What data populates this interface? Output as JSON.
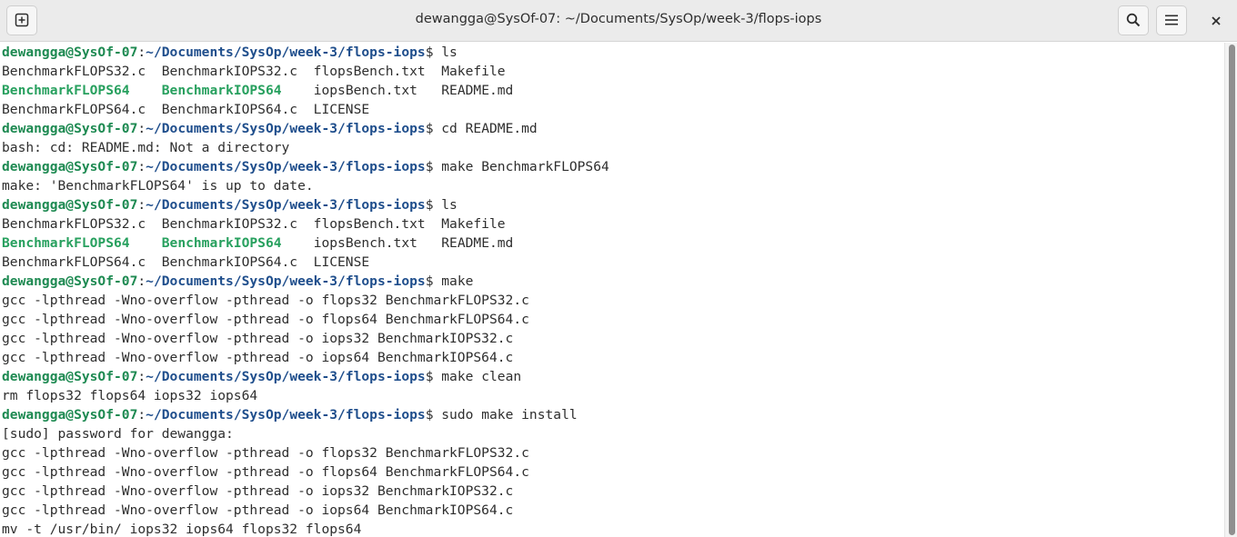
{
  "window": {
    "title": "dewangga@SysOf-07: ~/Documents/SysOp/week-3/flops-iops",
    "buttons": {
      "new_tab_icon": "new-tab-icon",
      "search_icon": "search-icon",
      "menu_icon": "hamburger-menu-icon",
      "close_icon": "close-icon"
    }
  },
  "colors": {
    "titlebar_bg": "#ebebeb",
    "terminal_bg": "#ffffff",
    "text": "#2e2e2e",
    "prompt_user": "#1e8a52",
    "prompt_path": "#1f4e8c",
    "executable": "#27a05e"
  },
  "terminal": {
    "lines": [
      {
        "segments": [
          {
            "t": "dewangga@SysOf-07",
            "c": "user"
          },
          {
            "t": ":",
            "c": "plain"
          },
          {
            "t": "~/Documents/SysOp/week-3/flops-iops",
            "c": "path"
          },
          {
            "t": "$ ls",
            "c": "plain"
          }
        ]
      },
      {
        "segments": [
          {
            "t": "BenchmarkFLOPS32.c  BenchmarkIOPS32.c  flopsBench.txt  Makefile",
            "c": "plain"
          }
        ]
      },
      {
        "segments": [
          {
            "t": "BenchmarkFLOPS64",
            "c": "exe"
          },
          {
            "t": "    ",
            "c": "plain"
          },
          {
            "t": "BenchmarkIOPS64",
            "c": "exe"
          },
          {
            "t": "    iopsBench.txt   README.md",
            "c": "plain"
          }
        ]
      },
      {
        "segments": [
          {
            "t": "BenchmarkFLOPS64.c  BenchmarkIOPS64.c  LICENSE",
            "c": "plain"
          }
        ]
      },
      {
        "segments": [
          {
            "t": "dewangga@SysOf-07",
            "c": "user"
          },
          {
            "t": ":",
            "c": "plain"
          },
          {
            "t": "~/Documents/SysOp/week-3/flops-iops",
            "c": "path"
          },
          {
            "t": "$ cd README.md",
            "c": "plain"
          }
        ]
      },
      {
        "segments": [
          {
            "t": "bash: cd: README.md: Not a directory",
            "c": "plain"
          }
        ]
      },
      {
        "segments": [
          {
            "t": "dewangga@SysOf-07",
            "c": "user"
          },
          {
            "t": ":",
            "c": "plain"
          },
          {
            "t": "~/Documents/SysOp/week-3/flops-iops",
            "c": "path"
          },
          {
            "t": "$ make BenchmarkFLOPS64",
            "c": "plain"
          }
        ]
      },
      {
        "segments": [
          {
            "t": "make: 'BenchmarkFLOPS64' is up to date.",
            "c": "plain"
          }
        ]
      },
      {
        "segments": [
          {
            "t": "dewangga@SysOf-07",
            "c": "user"
          },
          {
            "t": ":",
            "c": "plain"
          },
          {
            "t": "~/Documents/SysOp/week-3/flops-iops",
            "c": "path"
          },
          {
            "t": "$ ls",
            "c": "plain"
          }
        ]
      },
      {
        "segments": [
          {
            "t": "BenchmarkFLOPS32.c  BenchmarkIOPS32.c  flopsBench.txt  Makefile",
            "c": "plain"
          }
        ]
      },
      {
        "segments": [
          {
            "t": "BenchmarkFLOPS64",
            "c": "exe"
          },
          {
            "t": "    ",
            "c": "plain"
          },
          {
            "t": "BenchmarkIOPS64",
            "c": "exe"
          },
          {
            "t": "    iopsBench.txt   README.md",
            "c": "plain"
          }
        ]
      },
      {
        "segments": [
          {
            "t": "BenchmarkFLOPS64.c  BenchmarkIOPS64.c  LICENSE",
            "c": "plain"
          }
        ]
      },
      {
        "segments": [
          {
            "t": "dewangga@SysOf-07",
            "c": "user"
          },
          {
            "t": ":",
            "c": "plain"
          },
          {
            "t": "~/Documents/SysOp/week-3/flops-iops",
            "c": "path"
          },
          {
            "t": "$ make",
            "c": "plain"
          }
        ]
      },
      {
        "segments": [
          {
            "t": "gcc -lpthread -Wno-overflow -pthread -o flops32 BenchmarkFLOPS32.c",
            "c": "plain"
          }
        ]
      },
      {
        "segments": [
          {
            "t": "gcc -lpthread -Wno-overflow -pthread -o flops64 BenchmarkFLOPS64.c",
            "c": "plain"
          }
        ]
      },
      {
        "segments": [
          {
            "t": "gcc -lpthread -Wno-overflow -pthread -o iops32 BenchmarkIOPS32.c",
            "c": "plain"
          }
        ]
      },
      {
        "segments": [
          {
            "t": "gcc -lpthread -Wno-overflow -pthread -o iops64 BenchmarkIOPS64.c",
            "c": "plain"
          }
        ]
      },
      {
        "segments": [
          {
            "t": "dewangga@SysOf-07",
            "c": "user"
          },
          {
            "t": ":",
            "c": "plain"
          },
          {
            "t": "~/Documents/SysOp/week-3/flops-iops",
            "c": "path"
          },
          {
            "t": "$ make clean",
            "c": "plain"
          }
        ]
      },
      {
        "segments": [
          {
            "t": "rm flops32 flops64 iops32 iops64",
            "c": "plain"
          }
        ]
      },
      {
        "segments": [
          {
            "t": "dewangga@SysOf-07",
            "c": "user"
          },
          {
            "t": ":",
            "c": "plain"
          },
          {
            "t": "~/Documents/SysOp/week-3/flops-iops",
            "c": "path"
          },
          {
            "t": "$ sudo make install",
            "c": "plain"
          }
        ]
      },
      {
        "segments": [
          {
            "t": "[sudo] password for dewangga:",
            "c": "plain"
          }
        ]
      },
      {
        "segments": [
          {
            "t": "gcc -lpthread -Wno-overflow -pthread -o flops32 BenchmarkFLOPS32.c",
            "c": "plain"
          }
        ]
      },
      {
        "segments": [
          {
            "t": "gcc -lpthread -Wno-overflow -pthread -o flops64 BenchmarkFLOPS64.c",
            "c": "plain"
          }
        ]
      },
      {
        "segments": [
          {
            "t": "gcc -lpthread -Wno-overflow -pthread -o iops32 BenchmarkIOPS32.c",
            "c": "plain"
          }
        ]
      },
      {
        "segments": [
          {
            "t": "gcc -lpthread -Wno-overflow -pthread -o iops64 BenchmarkIOPS64.c",
            "c": "plain"
          }
        ]
      },
      {
        "segments": [
          {
            "t": "mv -t /usr/bin/ iops32 iops64 flops32 flops64",
            "c": "plain"
          }
        ]
      }
    ]
  }
}
